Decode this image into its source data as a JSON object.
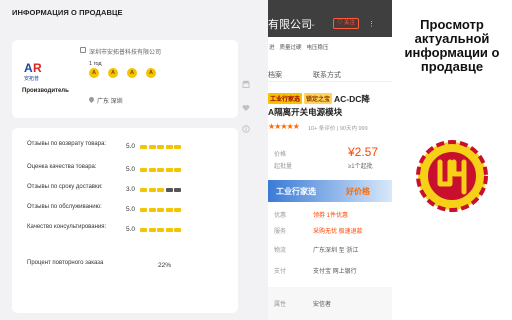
{
  "panel": {
    "title": "ИНФОРМАЦИЯ О ПРОДАВЦЕ",
    "company_name": "深圳市安拓普科技有限公司",
    "years": "1 год",
    "badges": [
      "A",
      "A",
      "A",
      "A"
    ],
    "role": "Производитель",
    "location": "广东 深圳",
    "logo_text": "安拓普",
    "ratings": [
      {
        "label": "Отзывы по возврату товара:",
        "value": "5.0",
        "level": 5
      },
      {
        "label": "Оценка качества товара:",
        "value": "5.0",
        "level": 5
      },
      {
        "label": "Отзывы по сроку доставки:",
        "value": "3.0",
        "level": 3
      },
      {
        "label": "Отзывы по обслуживанию:",
        "value": "5.0",
        "level": 5
      },
      {
        "label": "Качество консультирования:",
        "value": "5.0",
        "level": 5
      }
    ],
    "repeat_order": {
      "label": "Процент повторного заказа",
      "value": "22%"
    }
  },
  "colors": {
    "bar_active": "#f5c400",
    "bar_inactive": "#555555",
    "accent": "#ff4400",
    "logo_red": "#c8102e",
    "logo_yellow": "#f7d117"
  },
  "icons": [
    "store-icon",
    "heart-icon",
    "info-icon"
  ],
  "screenshot": {
    "company": "有限公司",
    "follow_button": "关注",
    "tags": [
      "进",
      "质量过硬",
      "电压稳压"
    ],
    "tabs": [
      "档案",
      "联系方式"
    ],
    "badge_factory": "工业行家选",
    "badge_good": "锁定之宝",
    "title_line1": "AC-DC降",
    "title_line2": "A隔离开关电源模块",
    "rating_text": "10+  条评价  |  90天内  999",
    "price_label": "价格",
    "price": "¥2.57",
    "min_qty_label": "起批量",
    "min_qty": "≥1个起批",
    "factory_banner": "工业行家选",
    "good_value": "好价格",
    "rows": [
      {
        "label": "优惠",
        "value": "领券  1件优惠"
      },
      {
        "label": "服务",
        "value": "采购无忧  极速退款"
      },
      {
        "label": "物流",
        "value": "广东深圳  至 浙江"
      },
      {
        "label": "支付",
        "value": "支付宝  网上银行"
      },
      {
        "label": "属性",
        "value": "安信者"
      }
    ]
  },
  "right": {
    "title": "Просмотр актуальной информации о продавце"
  }
}
